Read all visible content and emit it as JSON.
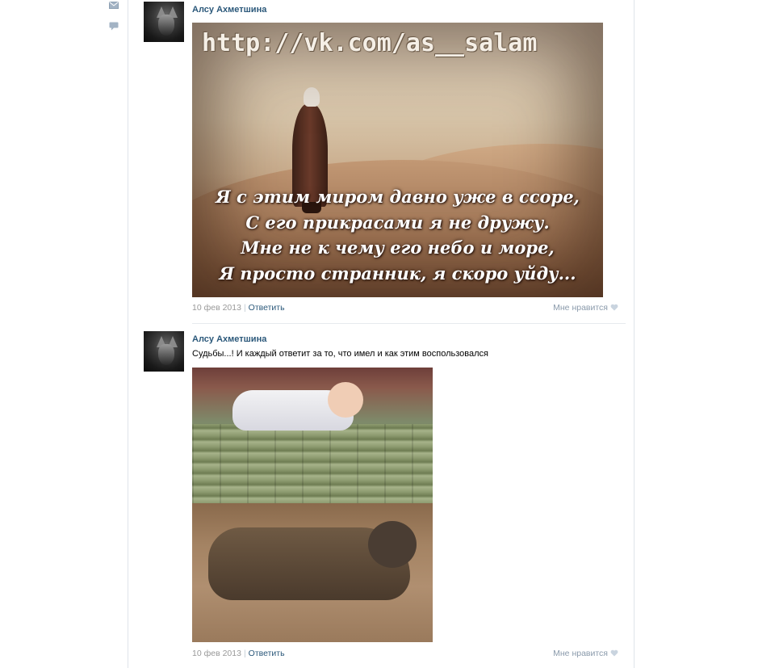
{
  "sidebar": {
    "icons": [
      "envelope-icon",
      "comment-icon"
    ]
  },
  "posts": [
    {
      "author": "Алсу Ахметшина",
      "text": "",
      "image": {
        "url_overlay": "http://vk.com/as__salam",
        "poem_lines": [
          "Я с этим миром давно уже в ссоре,",
          "С его прикрасами я не дружу.",
          "Мне не к чему его небо и море,",
          "Я просто странник, я скоро уйду..."
        ]
      },
      "date": "10 фев 2013",
      "reply_label": "Ответить",
      "like_label": "Мне нравится"
    },
    {
      "author": "Алсу Ахметшина",
      "text": "Судьбы...! И каждый ответит за то, что имел и как этим воспользовался",
      "date": "10 фев 2013",
      "reply_label": "Ответить",
      "like_label": "Мне нравится"
    }
  ],
  "colors": {
    "link": "#2b587a",
    "muted": "#999999",
    "like": "#8a9aab"
  }
}
